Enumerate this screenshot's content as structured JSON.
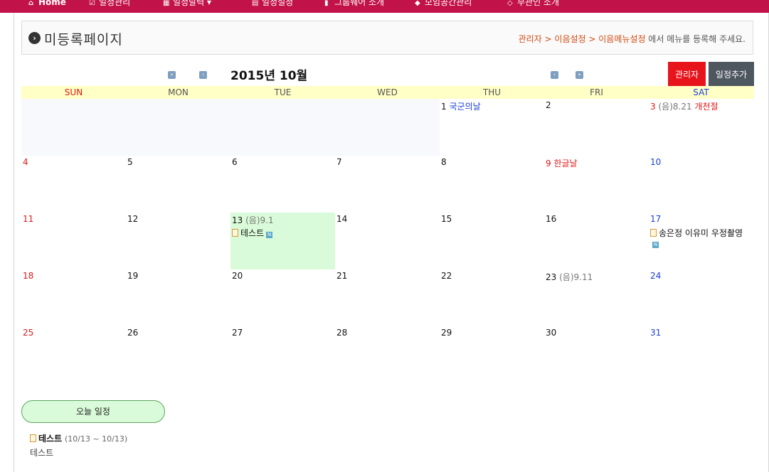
{
  "nav": {
    "items": [
      {
        "label": "Home",
        "icon": "home-icon"
      },
      {
        "label": "일정관리",
        "icon": "edit-icon"
      },
      {
        "label": "일정달력 ▾",
        "icon": "calendar-icon"
      },
      {
        "label": "일정설정",
        "icon": "table-icon"
      },
      {
        "label": "그룹웨어 소개",
        "icon": "bookmark-icon"
      },
      {
        "label": "모임공간관리",
        "icon": "car-icon"
      },
      {
        "label": "부관인 소개",
        "icon": "diamond-icon"
      }
    ],
    "bg_color": "#c2124a"
  },
  "titlebar": {
    "title": "미등록페이지",
    "notice_path": "관리자 > 이음설정 > 이음메뉴설정",
    "notice_text": " 에서 메뉴를 등록해 주세요."
  },
  "calendar": {
    "title": "2015년 10월",
    "prev_year": "«",
    "prev_month": "‹",
    "next_month": "›",
    "next_year": "»",
    "admin_label": "관리자",
    "add_label": "일정추가",
    "weekdays": [
      "SUN",
      "MON",
      "TUE",
      "WED",
      "THU",
      "FRI",
      "SAT"
    ],
    "days": {
      "d1": "1",
      "d1_holiday": "국군의날",
      "d2": "2",
      "d3": "3",
      "d3_lunar": "(음)8.21",
      "d3_holiday": "개천절",
      "d4": "4",
      "d5": "5",
      "d6": "6",
      "d7": "7",
      "d8": "8",
      "d9": "9",
      "d9_holiday": "한글날",
      "d10": "10",
      "d11": "11",
      "d12": "12",
      "d13": "13",
      "d13_lunar": "(음)9.1",
      "d13_event": "테스트",
      "d14": "14",
      "d15": "15",
      "d16": "16",
      "d17": "17",
      "d17_event": "송은정 이유미 우정촬영",
      "d18": "18",
      "d19": "19",
      "d20": "20",
      "d21": "21",
      "d22": "22",
      "d23": "23",
      "d23_lunar": "(음)9.11",
      "d24": "24",
      "d25": "25",
      "d26": "26",
      "d27": "27",
      "d28": "28",
      "d29": "29",
      "d30": "30",
      "d31": "31"
    },
    "new_badge": "N"
  },
  "today": {
    "button_label": "오늘 일정",
    "events": [
      {
        "title": "테스트",
        "range": "(10/13 ~ 10/13)",
        "desc": "테스트"
      }
    ]
  }
}
